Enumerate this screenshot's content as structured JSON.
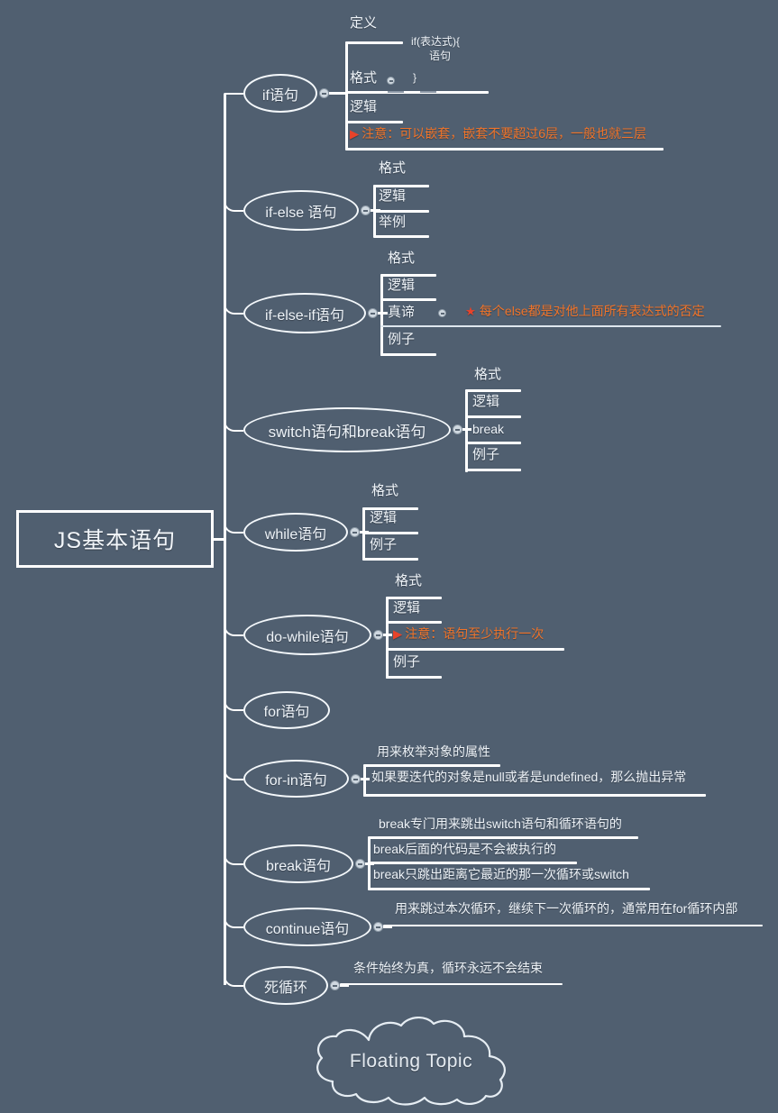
{
  "document": {
    "type": "mind-map",
    "background_color": "#505f70",
    "line_color": "#ffffff",
    "note_color": "#f0742a",
    "accent_color": "#e8432a"
  },
  "root": {
    "label": "JS基本语句"
  },
  "floating_topic": {
    "label": "Floating Topic",
    "shape": "cloud"
  },
  "branches": [
    {
      "label": "if语句",
      "children": [
        {
          "label": "定义"
        },
        {
          "label": "格式",
          "has_collapse_dot": true,
          "code_lines": [
            "if(表达式){",
            "语句",
            "}"
          ]
        },
        {
          "label": "逻辑"
        },
        {
          "label": "注意：可以嵌套，嵌套不要超过6层，一般也就三层",
          "style": "note",
          "icon": "red-flag-icon"
        }
      ]
    },
    {
      "label": "if-else 语句",
      "children": [
        {
          "label": "格式"
        },
        {
          "label": "逻辑"
        },
        {
          "label": "举例"
        }
      ]
    },
    {
      "label": "if-else-if语句",
      "children": [
        {
          "label": "格式"
        },
        {
          "label": "逻辑"
        },
        {
          "label": "真谛",
          "has_collapse_dot": true,
          "note": {
            "label": "每个else都是对他上面所有表达式的否定",
            "style": "note",
            "icon": "red-star-icon"
          }
        },
        {
          "label": "例子"
        }
      ]
    },
    {
      "label": "switch语句和break语句",
      "children": [
        {
          "label": "格式"
        },
        {
          "label": "逻辑"
        },
        {
          "label": "break"
        },
        {
          "label": "例子"
        }
      ]
    },
    {
      "label": "while语句",
      "children": [
        {
          "label": "格式"
        },
        {
          "label": "逻辑"
        },
        {
          "label": "例子"
        }
      ]
    },
    {
      "label": "do-while语句",
      "children": [
        {
          "label": "格式"
        },
        {
          "label": "逻辑"
        },
        {
          "label": "注意：语句至少执行一次",
          "style": "note",
          "icon": "red-flag-icon"
        },
        {
          "label": "例子"
        }
      ]
    },
    {
      "label": "for语句",
      "children": []
    },
    {
      "label": "for-in语句",
      "children": [
        {
          "label": "用来枚举对象的属性"
        },
        {
          "label": "如果要迭代的对象是null或者是undefined，那么抛出异常"
        }
      ]
    },
    {
      "label": "break语句",
      "children": [
        {
          "label": "break专门用来跳出switch语句和循环语句的"
        },
        {
          "label": "break后面的代码是不会被执行的"
        },
        {
          "label": "break只跳出距离它最近的那一次循环或switch"
        }
      ]
    },
    {
      "label": "continue语句",
      "children": [
        {
          "label": "用来跳过本次循环，继续下一次循环的，通常用在for循环内部"
        }
      ]
    },
    {
      "label": "死循环",
      "children": [
        {
          "label": "条件始终为真，循环永远不会结束"
        }
      ]
    }
  ]
}
